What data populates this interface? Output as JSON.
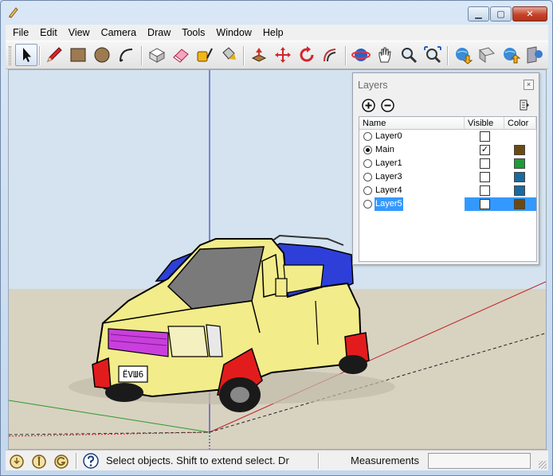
{
  "window": {
    "minimize_glyph": "▁",
    "maximize_glyph": "▢",
    "close_glyph": "✕"
  },
  "menu": [
    "File",
    "Edit",
    "View",
    "Camera",
    "Draw",
    "Tools",
    "Window",
    "Help"
  ],
  "toolbar": {
    "tools": [
      {
        "name": "select-tool",
        "icon": "arrow-cursor-icon"
      },
      {
        "name": "pencil-tool",
        "icon": "pencil-icon"
      },
      {
        "name": "rectangle-tool",
        "icon": "rectangle-icon"
      },
      {
        "name": "circle-tool",
        "icon": "circle-icon"
      },
      {
        "name": "arc-tool",
        "icon": "arc-icon"
      },
      {
        "name": "make-component-tool",
        "icon": "component-icon"
      },
      {
        "name": "eraser-tool",
        "icon": "eraser-icon"
      },
      {
        "name": "tape-measure-tool",
        "icon": "tape-measure-icon"
      },
      {
        "name": "paint-bucket-tool",
        "icon": "paint-bucket-icon"
      },
      {
        "name": "push-pull-tool",
        "icon": "push-pull-icon"
      },
      {
        "name": "move-tool",
        "icon": "move-icon"
      },
      {
        "name": "rotate-tool",
        "icon": "rotate-icon"
      },
      {
        "name": "offset-tool",
        "icon": "offset-icon"
      },
      {
        "name": "orbit-tool",
        "icon": "orbit-icon"
      },
      {
        "name": "pan-tool",
        "icon": "hand-icon"
      },
      {
        "name": "zoom-tool",
        "icon": "magnifier-icon"
      },
      {
        "name": "zoom-extents-tool",
        "icon": "zoom-extents-icon"
      },
      {
        "name": "get-models-tool",
        "icon": "globe-down-icon"
      },
      {
        "name": "share-model-tool",
        "icon": "globe-up-icon"
      },
      {
        "name": "share-component-tool",
        "icon": "share-component-icon"
      },
      {
        "name": "google-earth-tool",
        "icon": "google-earth-icon"
      }
    ]
  },
  "layers": {
    "title": "Layers",
    "close_glyph": "×",
    "columns": {
      "name": "Name",
      "visible": "Visible",
      "color": "Color"
    },
    "rows": [
      {
        "name": "Layer0",
        "active": false,
        "visible": false,
        "color": null,
        "selected": false
      },
      {
        "name": "Main",
        "active": true,
        "visible": true,
        "color": "#6b4a12",
        "selected": false
      },
      {
        "name": "Layer1",
        "active": false,
        "visible": false,
        "color": "#1f9a3a",
        "selected": false
      },
      {
        "name": "Layer3",
        "active": false,
        "visible": false,
        "color": "#1a6aa0",
        "selected": false
      },
      {
        "name": "Layer4",
        "active": false,
        "visible": false,
        "color": "#1a6aa0",
        "selected": false
      },
      {
        "name": "Layer5",
        "active": false,
        "visible": false,
        "color": "#6b4a12",
        "selected": true
      }
    ]
  },
  "scene": {
    "sky_color": "#d4e3ef",
    "ground_color": "#d8d2c1",
    "car_body_color": "#f2ec8a",
    "car_roof_color": "#2d3fd8",
    "car_fender_color": "#e21c1c",
    "car_grille_color": "#c93fdd",
    "license_plate_text": "ЁVШ6"
  },
  "status": {
    "message": "Select objects. Shift to extend select. Dr",
    "measurements_label": "Measurements",
    "measurements_value": ""
  }
}
